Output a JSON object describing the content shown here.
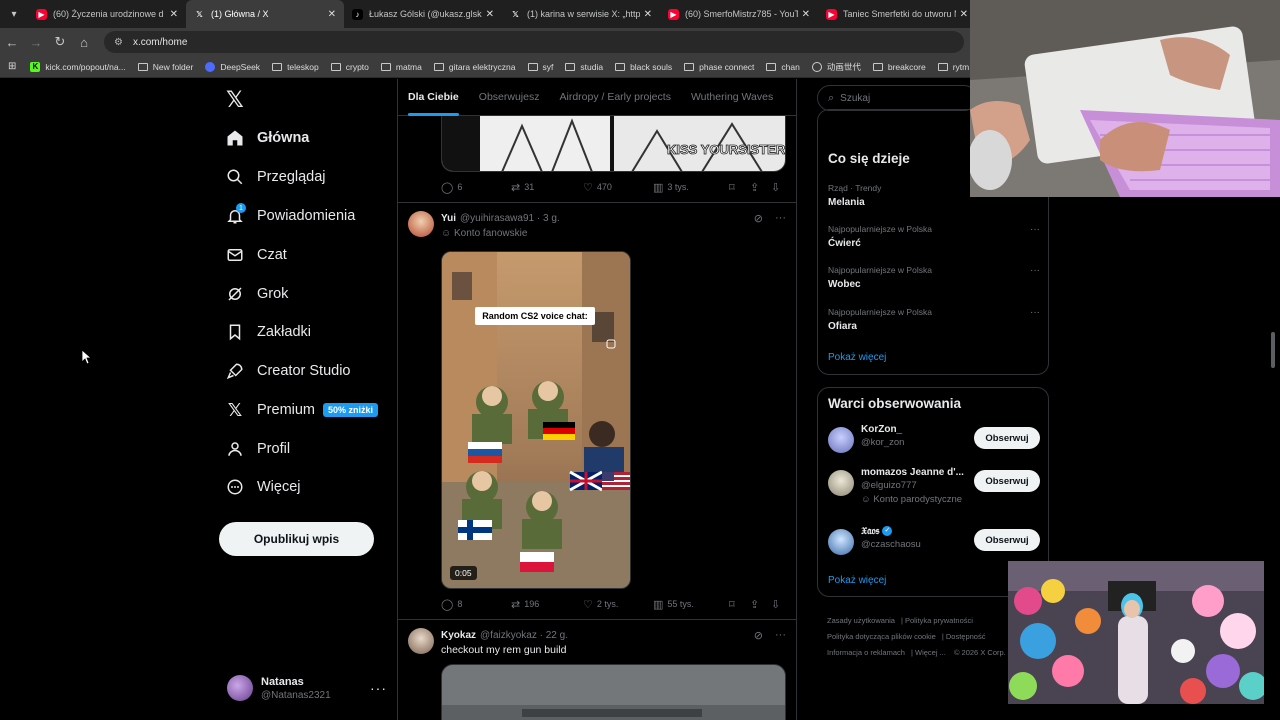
{
  "browser": {
    "tabs": [
      {
        "icon": "youtube",
        "title": "(60) Życzenia urodzinowe d",
        "active": false
      },
      {
        "icon": "x",
        "title": "(1) Główna / X",
        "active": true
      },
      {
        "icon": "tiktok",
        "title": "Łukasz Gólski (@ukasz.glski2) |",
        "active": false
      },
      {
        "icon": "x",
        "title": "(1) karina w serwisie X: „https:/",
        "active": false
      },
      {
        "icon": "youtube",
        "title": "(60) SmerfoMistrz785 - YouTub",
        "active": false
      },
      {
        "icon": "youtube",
        "title": "Taniec Smerfetki do utworu My",
        "active": false
      }
    ],
    "address": "x.com/home",
    "bookmarks": [
      {
        "icon": "kick",
        "label": "kick.com/popout/na..."
      },
      {
        "icon": "folder",
        "label": "New folder"
      },
      {
        "icon": "deepseek",
        "label": "DeepSeek"
      },
      {
        "icon": "folder",
        "label": "teleskop"
      },
      {
        "icon": "folder",
        "label": "crypto"
      },
      {
        "icon": "folder",
        "label": "matma"
      },
      {
        "icon": "folder",
        "label": "gitara elektryczna"
      },
      {
        "icon": "folder",
        "label": "syf"
      },
      {
        "icon": "folder",
        "label": "studia"
      },
      {
        "icon": "folder",
        "label": "black souls"
      },
      {
        "icon": "folder",
        "label": "phase connect"
      },
      {
        "icon": "folder",
        "label": "chan"
      },
      {
        "icon": "globe",
        "label": "动画世代"
      },
      {
        "icon": "folder",
        "label": "breakcore"
      },
      {
        "icon": "folder",
        "label": "rytm"
      }
    ]
  },
  "nav": {
    "items": [
      {
        "name": "home",
        "label": "Główna"
      },
      {
        "name": "explore",
        "label": "Przeglądaj"
      },
      {
        "name": "notifications",
        "label": "Powiadomienia",
        "badge": "1"
      },
      {
        "name": "chat",
        "label": "Czat"
      },
      {
        "name": "grok",
        "label": "Grok"
      },
      {
        "name": "bookmarks",
        "label": "Zakładki"
      },
      {
        "name": "creator-studio",
        "label": "Creator Studio"
      },
      {
        "name": "premium",
        "label": "Premium",
        "promo": "50% zniżki"
      },
      {
        "name": "profile",
        "label": "Profil"
      },
      {
        "name": "more",
        "label": "Więcej"
      }
    ],
    "post_button": "Opublikuj wpis",
    "account": {
      "display_name": "Natanas",
      "handle": "@Natanas2321"
    }
  },
  "timeline": {
    "tabs": [
      "Dla Ciebie",
      "Obserwujesz",
      "Airdropy / Early projects",
      "Wuthering Waves"
    ],
    "tweet1_stats": {
      "replies": "6",
      "reposts": "31",
      "likes": "470",
      "views": "3 tys."
    },
    "tweet2": {
      "name": "Yui",
      "handle": "@yuihirasawa91",
      "time": "3 g.",
      "label": "Konto fanowskie",
      "video_caption": "Random CS2 voice chat:",
      "duration": "0:05",
      "stats": {
        "replies": "8",
        "reposts": "196",
        "likes": "2 tys.",
        "views": "55 tys."
      }
    },
    "tweet3": {
      "name": "Kyokaz",
      "handle": "@faizkyokaz",
      "time": "22 g.",
      "text": "checkout my rem gun build"
    }
  },
  "right": {
    "search_placeholder": "Szukaj",
    "trends_title": "Co się dzieje",
    "trends": [
      {
        "context": "Rząd · Trendy",
        "topic": "Melania"
      },
      {
        "context": "Najpopularniejsze w Polska",
        "topic": "Ćwierć"
      },
      {
        "context": "Najpopularniejsze w Polska",
        "topic": "Wobec"
      },
      {
        "context": "Najpopularniejsze w Polska",
        "topic": "Ofiara"
      }
    ],
    "show_more": "Pokaż więcej",
    "who_title": "Warci obserwowania",
    "who": [
      {
        "name": "KorZon_",
        "handle": "@kor_zon",
        "extra": ""
      },
      {
        "name": "momazos Jeanne d'...",
        "handle": "@elguizo777",
        "extra": "Konto parodystyczne"
      },
      {
        "name": "𝔛𝔞𝔬𝔰",
        "handle": "@czaschaosu",
        "extra": ""
      }
    ],
    "follow_label": "Obserwuj",
    "show_more2": "Pokaż więcej",
    "footer": [
      "Zasady użytkowania",
      "Polityka prywatności",
      "Polityka dotycząca plików cookie",
      "Dostępność",
      "Informacja o reklamach",
      "Więcej ...",
      "© 2026 X Corp."
    ]
  }
}
